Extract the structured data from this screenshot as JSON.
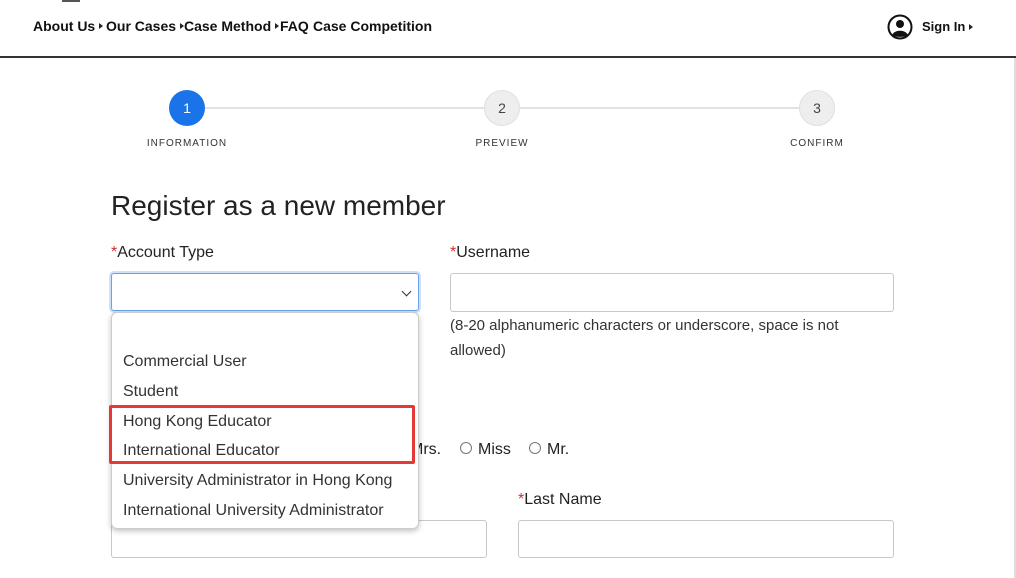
{
  "nav": {
    "items": [
      "About Us",
      "Our Cases",
      "Case Method",
      "FAQ",
      "Case Competition"
    ],
    "sign_in": "Sign In"
  },
  "stepper": {
    "steps": [
      {
        "number": "1",
        "label": "INFORMATION"
      },
      {
        "number": "2",
        "label": "PREVIEW"
      },
      {
        "number": "3",
        "label": "CONFIRM"
      }
    ],
    "active_step": 1
  },
  "form": {
    "title": "Register as a new member",
    "required_mark": "*",
    "account_type": {
      "label": "Account Type",
      "value": "",
      "options": [
        "",
        "Commercial User",
        "Student",
        "Hong Kong Educator",
        "International Educator",
        "University Administrator in Hong Kong",
        "International University Administrator"
      ]
    },
    "username": {
      "label": "Username",
      "value": "",
      "hint": "(8-20 alphanumeric characters or underscore, space is not allowed)"
    },
    "title_options": {
      "partial": "Mrs.",
      "miss": "Miss",
      "mr": "Mr."
    },
    "last_name": {
      "label": "Last Name",
      "value": ""
    }
  },
  "colors": {
    "accent": "#1a73e8",
    "required": "#d32f2f",
    "highlight": "#e53935"
  }
}
